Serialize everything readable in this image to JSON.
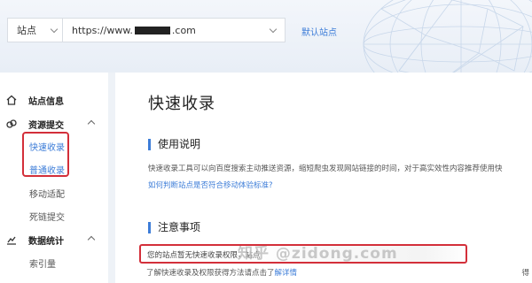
{
  "header": {
    "site_label": "站点",
    "site_url_prefix": "https://www.",
    "site_url_suffix": ".com",
    "default_site_link": "默认站点"
  },
  "sidebar": {
    "groups": [
      {
        "label": "站点信息",
        "icon": "home-icon"
      },
      {
        "label": "资源提交",
        "icon": "resource-submit-icon"
      },
      {
        "label": "数据统计",
        "icon": "stats-chart-icon"
      }
    ],
    "items": [
      {
        "label": "快速收录",
        "active": true
      },
      {
        "label": "普通收录",
        "active": true
      },
      {
        "label": "移动适配",
        "active": false
      },
      {
        "label": "死链提交",
        "active": false
      },
      {
        "label": "索引量",
        "active": false
      }
    ]
  },
  "main": {
    "title": "快速收录",
    "usage": {
      "heading": "使用说明",
      "text": "快速收录工具可以向百度搜索主动推送资源，缩短爬虫发现网站链接的时间，对于高实效性内容推荐使用快",
      "link": "如何判断站点是否符合移动体验标准?"
    },
    "notes": {
      "heading": "注意事项",
      "notice": "您的站点暂无快速收录权限，站点",
      "learn_more_prefix": "了解快速收录及权限获得方法请点击了",
      "learn_more_link": "解详情",
      "cut_right": "得"
    },
    "watermark": "知乎 @zidong.com"
  },
  "colors": {
    "accent": "#3d7dd8",
    "highlight_red": "#d32f3a"
  }
}
